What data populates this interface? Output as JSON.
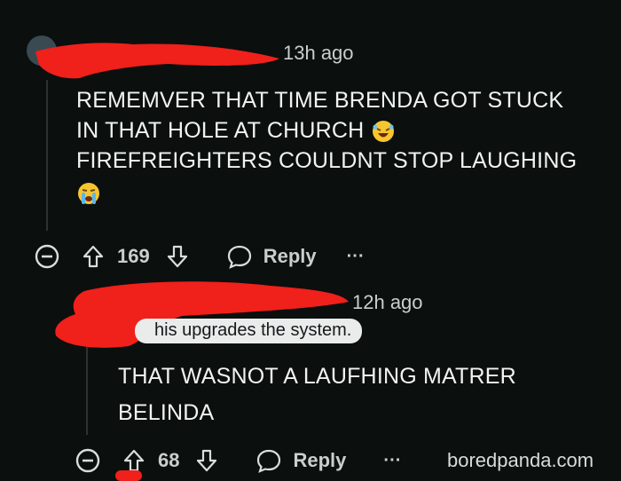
{
  "comment1": {
    "timestamp": "13h ago",
    "lines": [
      "REMEMVER THAT TIME BRENDA GOT STUCK",
      "IN THAT HOLE AT CHURCH",
      "FIREFREIGHTERS COULDNT STOP LAUGHING"
    ],
    "upvotes": "169",
    "reply_label": "Reply",
    "more_label": "···"
  },
  "comment2": {
    "timestamp": "12h ago",
    "flair": "his upgrades the system.",
    "lines": [
      "THAT WASNOT A LAUFHING MATRER",
      "BELINDA"
    ],
    "upvotes": "68",
    "reply_label": "Reply",
    "more_label": "···"
  },
  "watermark": "boredpanda.com",
  "colors": {
    "background": "#0b0f0e",
    "redaction": "#f0201a",
    "text": "#f0f3f2",
    "muted": "#c9cfcd"
  },
  "icons": [
    "collapse-icon",
    "upvote-icon",
    "downvote-icon",
    "reply-bubble-icon",
    "laughing-emoji",
    "crying-emoji"
  ]
}
